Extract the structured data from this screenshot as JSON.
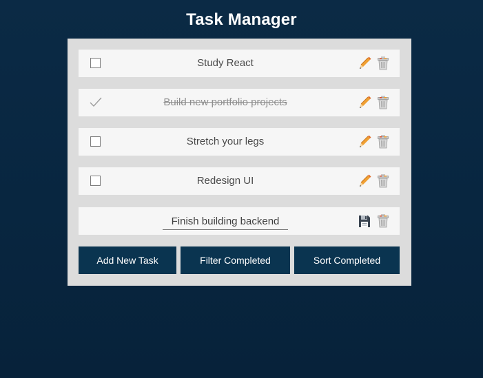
{
  "app": {
    "title": "Task Manager"
  },
  "tasks": [
    {
      "text": "Study React",
      "completed": false,
      "editing": false
    },
    {
      "text": "Build new portfolio projects",
      "completed": true,
      "editing": false
    },
    {
      "text": "Stretch your legs",
      "completed": false,
      "editing": false
    },
    {
      "text": "Redesign UI",
      "completed": false,
      "editing": false
    },
    {
      "text": "Finish building backend",
      "completed": false,
      "editing": true
    }
  ],
  "icons": {
    "edit": "pencil-icon",
    "delete": "trash-icon",
    "save": "floppy-disk-icon",
    "complete": "checkmark-icon"
  },
  "buttons": {
    "add": "Add New Task",
    "filter": "Filter Completed",
    "sort": "Sort Completed"
  },
  "colors": {
    "background": "#082640",
    "panel": "#dcdcdc",
    "task_row": "#f6f6f6",
    "button": "#0a3450",
    "pencil": "#e8912c"
  }
}
